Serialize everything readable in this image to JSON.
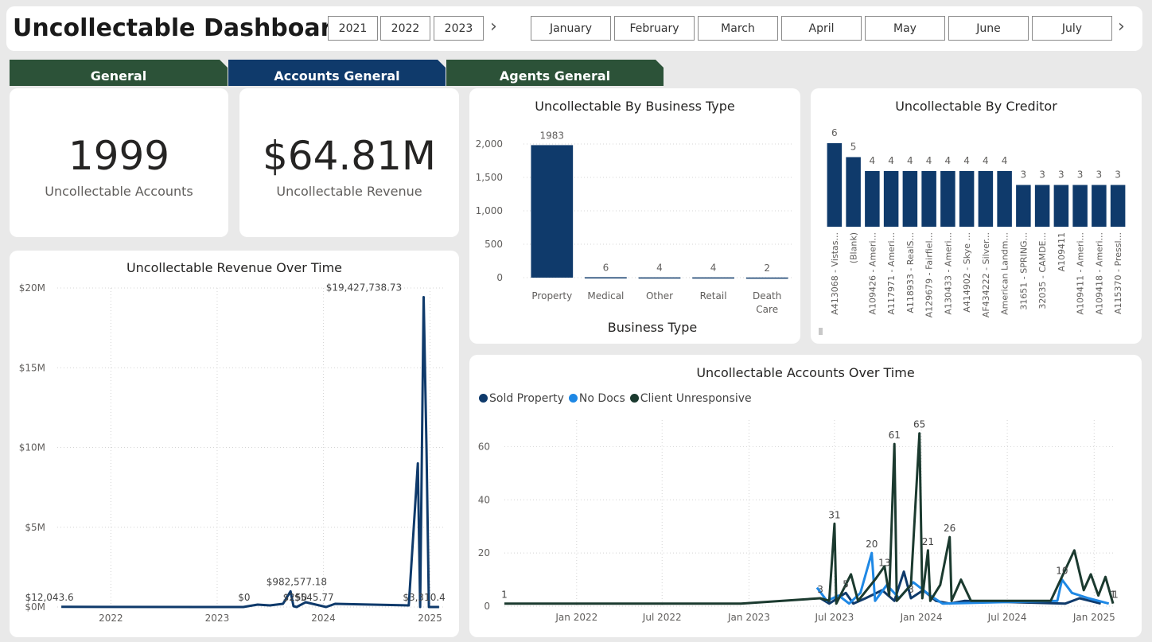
{
  "header": {
    "title": "Uncollectable Dashboard",
    "years": [
      "2021",
      "2022",
      "2023"
    ],
    "months": [
      "January",
      "February",
      "March",
      "April",
      "May",
      "June",
      "July"
    ],
    "next_icon": "chevron-right-icon"
  },
  "tabs": [
    {
      "label": "General",
      "active": false
    },
    {
      "label": "Accounts General",
      "active": true
    },
    {
      "label": "Agents General",
      "active": false
    }
  ],
  "kpis": [
    {
      "value": "1999",
      "label": "Uncollectable Accounts"
    },
    {
      "value": "$64.81M",
      "label": "Uncollectable Revenue"
    }
  ],
  "colors": {
    "navy": "#0f3a6b",
    "green_tab": "#2c5238",
    "sold_property": "#0f3a6b",
    "no_docs": "#1e88e5",
    "client_unresponsive": "#1b3a2f"
  },
  "chart_data": [
    {
      "id": "business_type",
      "type": "bar",
      "title": "Uncollectable By Business Type",
      "xlabel": "Business Type",
      "categories": [
        "Property",
        "Medical",
        "Other",
        "Retail",
        "Death Care"
      ],
      "values": [
        1983,
        6,
        4,
        4,
        2
      ],
      "data_labels": [
        "1983",
        "6",
        "4",
        "4",
        "2"
      ],
      "yticks": [
        "0",
        "500",
        "1,000",
        "1,500",
        "2,000"
      ],
      "ylim": [
        0,
        2000
      ],
      "grid": true
    },
    {
      "id": "creditor",
      "type": "bar",
      "title": "Uncollectable By Creditor",
      "categories": [
        "A413068 - Vistas...",
        "(Blank)",
        "A109426 - Ameri...",
        "A117971 - Ameri...",
        "A118933 - RealS...",
        "A129679 - Fairfiel...",
        "A130433 - Ameri...",
        "A414902 - Skye ...",
        "AF434222 - Silver...",
        "American Landm...",
        "31651 - SPRING...",
        "32035 - CAMDE...",
        "A109411",
        "A109411 - Ameri...",
        "A109418 - Ameri...",
        "A115370 - Pressl..."
      ],
      "values": [
        6,
        5,
        4,
        4,
        4,
        4,
        4,
        4,
        4,
        4,
        3,
        3,
        3,
        3,
        3,
        3
      ],
      "data_labels": [
        "6",
        "5",
        "4",
        "4",
        "4",
        "4",
        "4",
        "4",
        "4",
        "4",
        "3",
        "3",
        "3",
        "3",
        "3",
        "3"
      ],
      "ylim": [
        0,
        6
      ]
    },
    {
      "id": "revenue_time",
      "type": "line",
      "title": "Uncollectable Revenue Over Time",
      "xticks": [
        "2022",
        "2023",
        "2024",
        "2025"
      ],
      "yticks": [
        "$0M",
        "$5M",
        "$10M",
        "$15M",
        "$20M"
      ],
      "xlim": [
        "2021-07-01",
        "2025-02-15"
      ],
      "ylim": [
        0,
        20000000
      ],
      "grid": true,
      "points": [
        {
          "x": "2021-07-15",
          "y": 12043.6
        },
        {
          "x": "2023-04-01",
          "y": 0
        },
        {
          "x": "2023-05-20",
          "y": 150000
        },
        {
          "x": "2023-07-01",
          "y": 100000
        },
        {
          "x": "2023-08-15",
          "y": 200000
        },
        {
          "x": "2023-09-10",
          "y": 982577.18
        },
        {
          "x": "2023-09-20",
          "y": 50000
        },
        {
          "x": "2023-10-01",
          "y": 250
        },
        {
          "x": "2023-11-01",
          "y": 300000
        },
        {
          "x": "2024-01-10",
          "y": 545.77
        },
        {
          "x": "2024-02-10",
          "y": 200000
        },
        {
          "x": "2024-10-20",
          "y": 100000
        },
        {
          "x": "2024-11-20",
          "y": 9000000
        },
        {
          "x": "2024-11-28",
          "y": 0
        },
        {
          "x": "2024-12-10",
          "y": 19427738.73
        },
        {
          "x": "2024-12-20",
          "y": 9900000
        },
        {
          "x": "2024-12-28",
          "y": 310.4
        },
        {
          "x": "2025-02-01",
          "y": 0
        }
      ],
      "annotations": [
        {
          "x": "2021-07-15",
          "y": 12043.6,
          "label": "$12,043.6"
        },
        {
          "x": "2023-05-01",
          "y": 0,
          "label": "$0"
        },
        {
          "x": "2023-10-01",
          "y": 982577.18,
          "label": "$982,577.18"
        },
        {
          "x": "2023-10-01",
          "y": 250,
          "label": "$250"
        },
        {
          "x": "2024-01-10",
          "y": 545.77,
          "label": "$545.77"
        },
        {
          "x": "2024-12-10",
          "y": 19427738.73,
          "label": "$19,427,738.73"
        },
        {
          "x": "2024-12-28",
          "y": 310.4,
          "label": "$3,310.4"
        }
      ]
    },
    {
      "id": "accounts_time",
      "type": "line",
      "title": "Uncollectable Accounts Over Time",
      "legend": [
        "Sold Property",
        "No Docs",
        "Client Unresponsive"
      ],
      "xticks": [
        "Jan 2022",
        "Jul 2022",
        "Jan 2023",
        "Jul 2023",
        "Jan 2024",
        "Jul 2024",
        "Jan 2025"
      ],
      "yticks": [
        "0",
        "20",
        "40",
        "60"
      ],
      "xlim": [
        "2021-08-01",
        "2025-02-15"
      ],
      "ylim": [
        0,
        70
      ],
      "grid": true,
      "series": [
        {
          "name": "Sold Property",
          "color": "#0f3a6b",
          "points": [
            {
              "x": "2023-06-01",
              "y": 3
            },
            {
              "x": "2023-06-20",
              "y": 1
            },
            {
              "x": "2023-07-25",
              "y": 5
            },
            {
              "x": "2023-08-10",
              "y": 1
            },
            {
              "x": "2023-09-05",
              "y": 3
            },
            {
              "x": "2023-10-10",
              "y": 6
            },
            {
              "x": "2023-11-05",
              "y": 2
            },
            {
              "x": "2023-11-25",
              "y": 13
            },
            {
              "x": "2023-12-10",
              "y": 3
            },
            {
              "x": "2024-01-05",
              "y": 6
            },
            {
              "x": "2024-02-01",
              "y": 2
            },
            {
              "x": "2024-03-01",
              "y": 1
            },
            {
              "x": "2024-04-01",
              "y": 2
            },
            {
              "x": "2024-11-01",
              "y": 1
            },
            {
              "x": "2024-12-01",
              "y": 3
            },
            {
              "x": "2025-01-15",
              "y": 1
            }
          ]
        },
        {
          "name": "No Docs",
          "color": "#1e88e5",
          "points": [
            {
              "x": "2023-05-25",
              "y": 7
            },
            {
              "x": "2023-06-15",
              "y": 2
            },
            {
              "x": "2023-07-10",
              "y": 4
            },
            {
              "x": "2023-08-01",
              "y": 1
            },
            {
              "x": "2023-08-25",
              "y": 5
            },
            {
              "x": "2023-09-18",
              "y": 20
            },
            {
              "x": "2023-09-25",
              "y": 2
            },
            {
              "x": "2023-10-20",
              "y": 8
            },
            {
              "x": "2023-11-15",
              "y": 3
            },
            {
              "x": "2023-12-15",
              "y": 9
            },
            {
              "x": "2024-01-20",
              "y": 4
            },
            {
              "x": "2024-02-15",
              "y": 1
            },
            {
              "x": "2024-10-15",
              "y": 2
            },
            {
              "x": "2024-10-25",
              "y": 10
            },
            {
              "x": "2024-11-15",
              "y": 5
            },
            {
              "x": "2024-12-20",
              "y": 3
            },
            {
              "x": "2025-02-01",
              "y": 1
            }
          ]
        },
        {
          "name": "Client Unresponsive",
          "color": "#1b3a2f",
          "points": [
            {
              "x": "2021-08-01",
              "y": 1
            },
            {
              "x": "2022-12-15",
              "y": 1
            },
            {
              "x": "2023-06-01",
              "y": 3
            },
            {
              "x": "2023-06-20",
              "y": 2
            },
            {
              "x": "2023-07-01",
              "y": 31
            },
            {
              "x": "2023-07-05",
              "y": 1
            },
            {
              "x": "2023-08-05",
              "y": 12
            },
            {
              "x": "2023-08-20",
              "y": 2
            },
            {
              "x": "2023-09-25",
              "y": 10
            },
            {
              "x": "2023-10-15",
              "y": 15
            },
            {
              "x": "2023-10-25",
              "y": 4
            },
            {
              "x": "2023-11-05",
              "y": 61
            },
            {
              "x": "2023-11-10",
              "y": 2
            },
            {
              "x": "2023-12-10",
              "y": 8
            },
            {
              "x": "2023-12-28",
              "y": 65
            },
            {
              "x": "2024-01-03",
              "y": 3
            },
            {
              "x": "2024-01-15",
              "y": 21
            },
            {
              "x": "2024-01-20",
              "y": 2
            },
            {
              "x": "2024-02-10",
              "y": 8
            },
            {
              "x": "2024-03-01",
              "y": 26
            },
            {
              "x": "2024-03-05",
              "y": 2
            },
            {
              "x": "2024-03-25",
              "y": 10
            },
            {
              "x": "2024-04-15",
              "y": 2
            },
            {
              "x": "2024-10-01",
              "y": 2
            },
            {
              "x": "2024-11-20",
              "y": 21
            },
            {
              "x": "2024-12-10",
              "y": 6
            },
            {
              "x": "2024-12-25",
              "y": 12
            },
            {
              "x": "2025-01-10",
              "y": 4
            },
            {
              "x": "2025-01-25",
              "y": 11
            },
            {
              "x": "2025-02-10",
              "y": 1
            }
          ]
        }
      ],
      "annotations": [
        {
          "x": "2021-08-01",
          "y": 1,
          "label": "1"
        },
        {
          "x": "2023-06-01",
          "y": 3,
          "label": "3"
        },
        {
          "x": "2023-07-01",
          "y": 31,
          "label": "31"
        },
        {
          "x": "2023-07-25",
          "y": 5,
          "label": "5"
        },
        {
          "x": "2023-09-18",
          "y": 20,
          "label": "20"
        },
        {
          "x": "2023-10-15",
          "y": 13,
          "label": "13"
        },
        {
          "x": "2023-11-05",
          "y": 61,
          "label": "61"
        },
        {
          "x": "2023-12-10",
          "y": 3,
          "label": "3"
        },
        {
          "x": "2023-12-28",
          "y": 65,
          "label": "65"
        },
        {
          "x": "2024-01-15",
          "y": 21,
          "label": "21"
        },
        {
          "x": "2024-03-01",
          "y": 26,
          "label": "26"
        },
        {
          "x": "2024-10-25",
          "y": 10,
          "label": "10"
        },
        {
          "x": "2025-02-10",
          "y": 1,
          "label": "1"
        },
        {
          "x": "2025-02-15",
          "y": 1,
          "label": "1"
        }
      ]
    }
  ]
}
